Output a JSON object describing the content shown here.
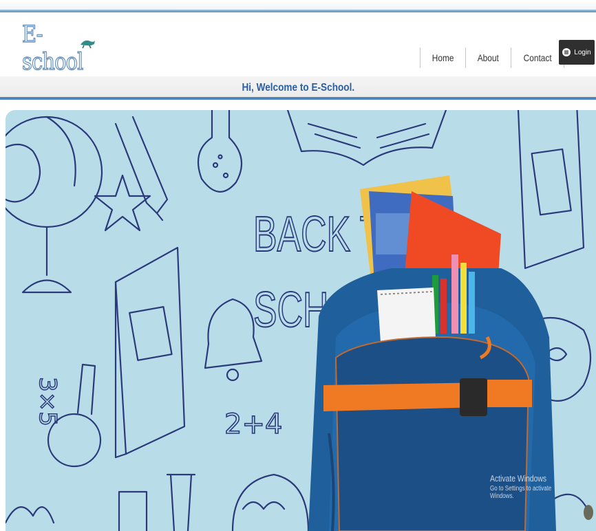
{
  "logo": {
    "text": "E-school"
  },
  "nav": {
    "home": "Home",
    "about": "About",
    "contact": "Contact",
    "login": "Login"
  },
  "welcome": "Hi, Welcome to E-School.",
  "hero": {
    "headline_line1": "BACK TO",
    "headline_line2": "SCHOOL",
    "doodle_math": "3×5",
    "doodle_sum": "2+4"
  },
  "watermark": {
    "title": "Activate Windows",
    "subtitle": "Go to Settings to activate Windows."
  },
  "colors": {
    "accent": "#4e87b7",
    "welcome_text": "#2b5fa3",
    "hero_bg": "#b8dce8",
    "doodle_ink": "#2a3a7a",
    "login_bg": "#2f2f2f",
    "bag_blue": "#1f5f9c",
    "strap_orange": "#f07a23"
  },
  "icons": {
    "logo": "turtle-bird-icon",
    "login": "user-icon"
  }
}
